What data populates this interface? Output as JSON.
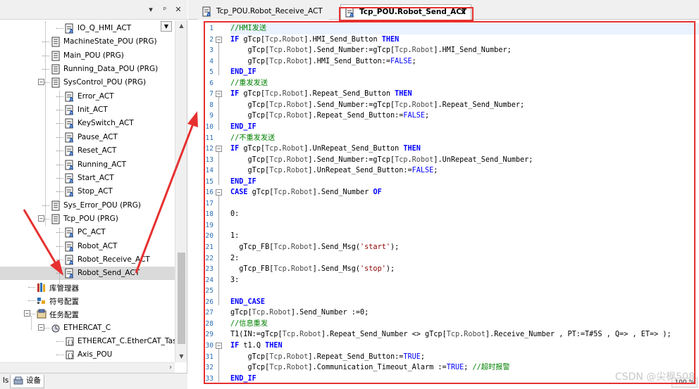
{
  "colors": {
    "accent_red": "#e63030",
    "keyword": "#0000ff",
    "comment": "#008000",
    "line_number": "#2b6fb3"
  },
  "left_pane": {
    "header_buttons": [
      "▾",
      "ᵖ",
      "✕"
    ],
    "tree": [
      {
        "label": "IO_Q_HMI_ACT",
        "icon": "action-icon"
      },
      {
        "label": "MachineState_POU (PRG)",
        "icon": "pou-icon"
      },
      {
        "label": "Main_POU (PRG)",
        "icon": "pou-icon"
      },
      {
        "label": "Running_Data_POU (PRG)",
        "icon": "pou-icon"
      },
      {
        "label": "SysControl_POU (PRG)",
        "icon": "pou-icon"
      },
      {
        "label": "Error_ACT",
        "icon": "action-icon"
      },
      {
        "label": "Init_ACT",
        "icon": "action-icon"
      },
      {
        "label": "KeySwitch_ACT",
        "icon": "action-icon"
      },
      {
        "label": "Pause_ACT",
        "icon": "action-icon"
      },
      {
        "label": "Reset_ACT",
        "icon": "action-icon"
      },
      {
        "label": "Running_ACT",
        "icon": "action-icon"
      },
      {
        "label": "Start_ACT",
        "icon": "action-icon"
      },
      {
        "label": "Stop_ACT",
        "icon": "action-icon"
      },
      {
        "label": "Sys_Error_POU (PRG)",
        "icon": "pou-icon"
      },
      {
        "label": "Tcp_POU (PRG)",
        "icon": "pou-icon"
      },
      {
        "label": "PC_ACT",
        "icon": "action-icon"
      },
      {
        "label": "Robot_ACT",
        "icon": "action-icon"
      },
      {
        "label": "Robot_Receive_ACT",
        "icon": "action-icon"
      },
      {
        "label": "Robot_Send_ACT",
        "icon": "action-icon"
      },
      {
        "label": "库管理器",
        "icon": "library-icon"
      },
      {
        "label": "符号配置",
        "icon": "symbol-config-icon"
      },
      {
        "label": "任务配置",
        "icon": "task-config-icon"
      },
      {
        "label": "ETHERCAT_C",
        "icon": "task-icon"
      },
      {
        "label": "ETHERCAT_C.EtherCAT_Task",
        "icon": "call-icon"
      },
      {
        "label": "Axis_POU",
        "icon": "call-icon"
      }
    ],
    "bottom_tabs": [
      "ls",
      "设备"
    ]
  },
  "tabs": [
    {
      "label": "Tcp_POU.Robot_Receive_ACT",
      "active": false
    },
    {
      "label": "Tcp_POU.Robot_Send_ACT",
      "active": true,
      "close": "x"
    }
  ],
  "editor": {
    "line_numbers": [
      "1",
      "2",
      "3",
      "4",
      "5",
      "6",
      "7",
      "8",
      "9",
      "10",
      "11",
      "12",
      "13",
      "14",
      "15",
      "16",
      "17",
      "18",
      "19",
      "20",
      "21",
      "22",
      "23",
      "24",
      "25",
      "26",
      "27",
      "28",
      "29",
      "30",
      "31",
      "32",
      "33"
    ],
    "lines": [
      "//HMI发送",
      "IF gTcp[Tcp.Robot].HMI_Send_Button THEN",
      "    gTcp[Tcp.Robot].Send_Number:=gTcp[Tcp.Robot].HMI_Send_Number;",
      "    gTcp[Tcp.Robot].HMI_Send_Button:=FALSE;",
      "END_IF",
      "//重发发送",
      "IF gTcp[Tcp.Robot].Repeat_Send_Button THEN",
      "    gTcp[Tcp.Robot].Send_Number:=gTcp[Tcp.Robot].Repeat_Send_Number;",
      "    gTcp[Tcp.Robot].Repeat_Send_Button:=FALSE;",
      "END_IF",
      "//不重发发送",
      "IF gTcp[Tcp.Robot].UnRepeat_Send_Button THEN",
      "    gTcp[Tcp.Robot].Send_Number:=gTcp[Tcp.Robot].UnRepeat_Send_Number;",
      "    gTcp[Tcp.Robot].UnRepeat_Send_Button:=FALSE;",
      "END_IF",
      "CASE gTcp[Tcp.Robot].Send_Number OF",
      "",
      "0:",
      "",
      "1:",
      "  gTcp_FB[Tcp.Robot].Send_Msg('start');",
      "2:",
      "  gTcp_FB[Tcp.Robot].Send_Msg('stop');",
      "3:",
      "",
      "END_CASE",
      "gTcp[Tcp.Robot].Send_Number :=0;",
      "//信息重发",
      "T1(IN:=gTcp[Tcp.Robot].Repeat_Send_Number <> gTcp[Tcp.Robot].Receive_Number , PT:=T#5S , Q=> , ET=> );",
      "IF t1.Q THEN",
      "    gTcp[Tcp.Robot].Repeat_Send_Button:=TRUE;",
      "    gTcp[Tcp.Robot].Communication_Timeout_Alarm :=TRUE; //超时报警",
      "END_IF"
    ],
    "zoom": "100 %"
  },
  "watermark": "CSDN @尖枫508"
}
